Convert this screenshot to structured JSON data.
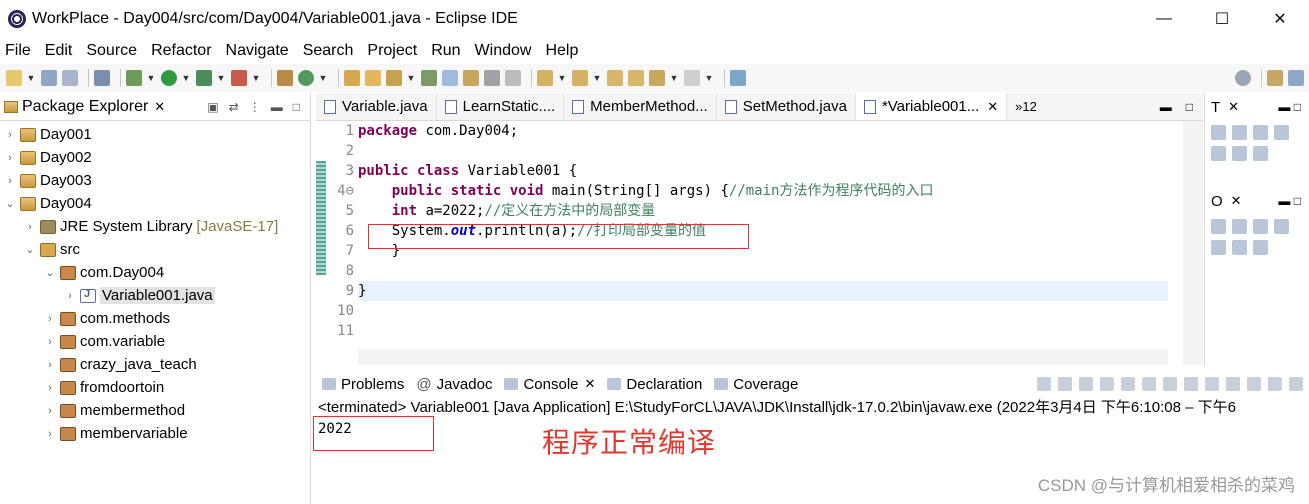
{
  "window": {
    "title": "WorkPlace - Day004/src/com/Day004/Variable001.java - Eclipse IDE",
    "minimize": "—",
    "maximize": "☐",
    "close": "✕"
  },
  "menu": [
    "File",
    "Edit",
    "Source",
    "Refactor",
    "Navigate",
    "Search",
    "Project",
    "Run",
    "Window",
    "Help"
  ],
  "package_explorer": {
    "title": "Package Explorer",
    "close": "✕",
    "items": [
      {
        "label": "Day001",
        "arrow": "›",
        "icon": "project-icon"
      },
      {
        "label": "Day002",
        "arrow": "›",
        "icon": "project-icon"
      },
      {
        "label": "Day003",
        "arrow": "›",
        "icon": "project-icon"
      },
      {
        "label": "Day004",
        "arrow": "⌄",
        "icon": "project-icon"
      },
      {
        "label": "JRE System Library",
        "decoration": "[JavaSE-17]",
        "arrow": "›",
        "icon": "library-icon"
      },
      {
        "label": "src",
        "arrow": "⌄",
        "icon": "source-folder-icon"
      },
      {
        "label": "com.Day004",
        "arrow": "⌄",
        "icon": "package-icon"
      },
      {
        "label": "Variable001.java",
        "arrow": "›",
        "icon": "java-file-icon"
      },
      {
        "label": "com.methods",
        "arrow": "›",
        "icon": "package-icon"
      },
      {
        "label": "com.variable",
        "arrow": "›",
        "icon": "package-icon"
      },
      {
        "label": "crazy_java_teach",
        "arrow": "›",
        "icon": "package-icon"
      },
      {
        "label": "fromdoortoin",
        "arrow": "›",
        "icon": "package-icon"
      },
      {
        "label": "membermethod",
        "arrow": "›",
        "icon": "package-icon"
      },
      {
        "label": "membervariable",
        "arrow": "›",
        "icon": "package-icon"
      }
    ]
  },
  "editor": {
    "tabs": [
      {
        "label": "Variable.java"
      },
      {
        "label": "LearnStatic...."
      },
      {
        "label": "MemberMethod..."
      },
      {
        "label": "SetMethod.java"
      },
      {
        "label": "*Variable001...",
        "active": true,
        "close": "✕"
      }
    ],
    "overflow": "»12",
    "line_numbers": [
      "1",
      "2",
      "3",
      "4⊖",
      "5",
      "6",
      "7",
      "8",
      "9",
      "10",
      "11"
    ],
    "code": {
      "l1_kw": "package",
      "l1_rest": " com.Day004;",
      "l3_kw": "public class",
      "l3_rest": " Variable001 {",
      "l4_indent": "    ",
      "l4_kw": "public static void",
      "l4_rest": " main(String[] args) {",
      "l4_comment": "//main方法作为程序代码的入口",
      "l5_indent": "    ",
      "l5_kw": "int",
      "l5_rest": " a=2022;",
      "l5_comment": "//定义在方法中的局部变量",
      "l6_prefix": "    System.",
      "l6_field": "out",
      "l6_rest": ".println(a);",
      "l6_comment": "//打印局部变量的值",
      "l7": "    }",
      "l9": "}"
    }
  },
  "right_panels": {
    "top_tab": "T",
    "bottom_tab": "O",
    "close": "✕"
  },
  "console": {
    "tabs": [
      {
        "label": "Problems"
      },
      {
        "label": "Javadoc",
        "prefix": "@"
      },
      {
        "label": "Console",
        "active": true,
        "close": "✕"
      },
      {
        "label": "Declaration"
      },
      {
        "label": "Coverage"
      }
    ],
    "terminated_line": "<terminated> Variable001 [Java Application] E:\\StudyForCL\\JAVA\\JDK\\Install\\jdk-17.0.2\\bin\\javaw.exe  (2022年3月4日 下午6:10:08 – 下午6",
    "output": "2022",
    "annotation": "程序正常编译"
  },
  "watermark": "CSDN @与计算机相爱相杀的菜鸡",
  "colors": {
    "keyword": "#7f0055",
    "comment": "#3f7f5f",
    "field": "#0000c0",
    "annotation": "#e0382f",
    "highlight_box": "#d23a3a"
  }
}
